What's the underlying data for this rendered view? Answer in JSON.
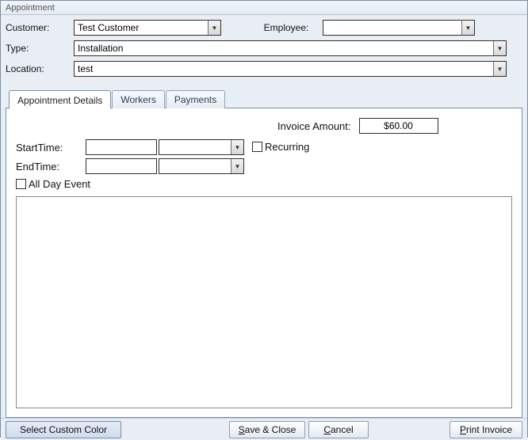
{
  "window": {
    "title": "Appointment"
  },
  "header": {
    "customer_label": "Customer:",
    "customer_value": "Test Customer",
    "employee_label": "Employee:",
    "employee_value": "",
    "type_label": "Type:",
    "type_value": "Installation",
    "location_label": "Location:",
    "location_value": "test"
  },
  "tabs": {
    "0": {
      "label": "Appointment Details"
    },
    "1": {
      "label": "Workers"
    },
    "2": {
      "label": "Payments"
    }
  },
  "details": {
    "invoice_label": "Invoice Amount:",
    "invoice_value": "$60.00",
    "start_label": "StartTime:",
    "start_date": "",
    "start_time": "",
    "end_label": "EndTime:",
    "end_date": "",
    "end_time": "",
    "recurring_label": "Recurring",
    "allday_label": "All Day Event",
    "notes": ""
  },
  "buttons": {
    "color": "Select Custom Color",
    "save": "Save & Close",
    "cancel": "Cancel",
    "print": "Print Invoice"
  }
}
